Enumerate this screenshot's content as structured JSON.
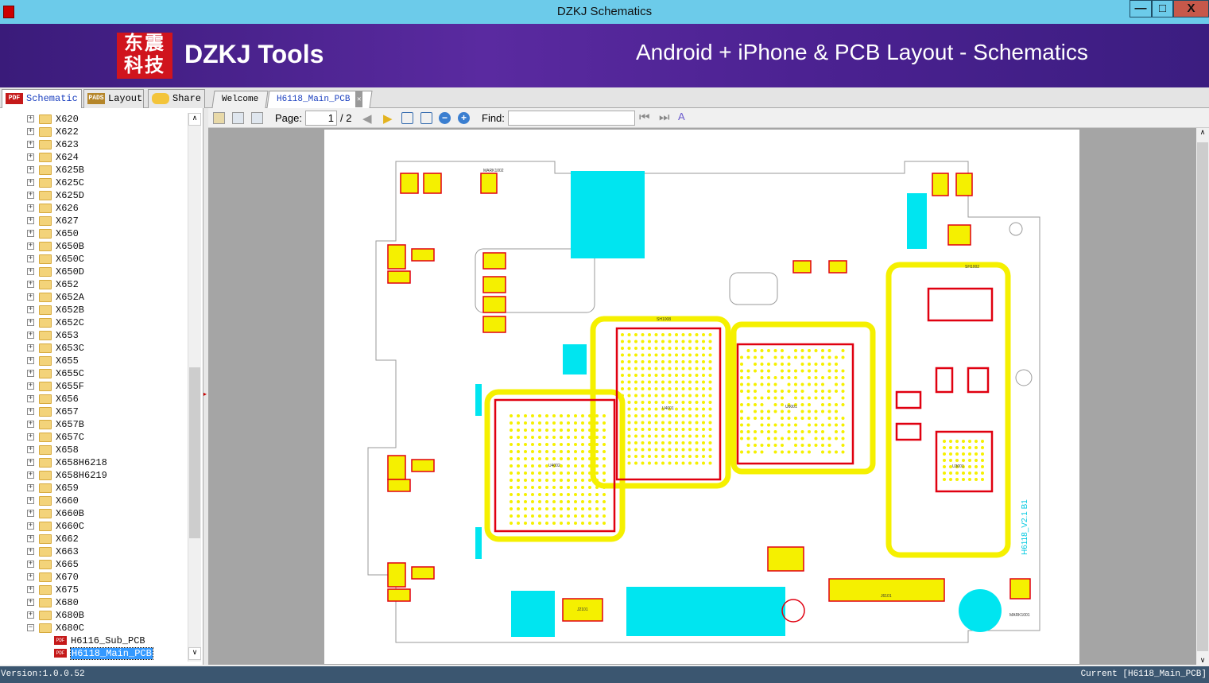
{
  "window": {
    "title": "DZKJ Schematics",
    "minimize": "—",
    "maximize": "□",
    "close": "X"
  },
  "banner": {
    "logo_text": "东震科技",
    "brand": "DZKJ Tools",
    "tagline": "Android + iPhone & PCB Layout - Schematics"
  },
  "left_tabs": [
    {
      "label": "Schematic",
      "icon": "pdf-icon",
      "badge": "PDF"
    },
    {
      "label": "Layout",
      "icon": "pads-icon",
      "badge": "PADS"
    },
    {
      "label": "Share",
      "icon": "cloud-share-icon"
    }
  ],
  "doc_tabs": [
    {
      "label": "Welcome"
    },
    {
      "label": "H6118_Main_PCB",
      "active": true
    }
  ],
  "toolbar": {
    "page_label": "Page:",
    "page_value": "1",
    "page_total": "/ 2",
    "find_label": "Find:",
    "find_value": ""
  },
  "tree": {
    "folders": [
      "X620",
      "X622",
      "X623",
      "X624",
      "X625B",
      "X625C",
      "X625D",
      "X626",
      "X627",
      "X650",
      "X650B",
      "X650C",
      "X650D",
      "X652",
      "X652A",
      "X652B",
      "X652C",
      "X653",
      "X653C",
      "X655",
      "X655C",
      "X655F",
      "X656",
      "X657",
      "X657B",
      "X657C",
      "X658",
      "X658H6218",
      "X658H6219",
      "X659",
      "X660",
      "X660B",
      "X660C",
      "X662",
      "X663",
      "X665",
      "X670",
      "X675",
      "X680",
      "X680B"
    ],
    "expanded": "X680C",
    "files": [
      "H6116_Sub_PCB",
      "H6118_Main_PCB"
    ],
    "selected": "H6118_Main_PCB"
  },
  "pcb": {
    "labels": {
      "u4001": "U4001",
      "u4002": "U4002",
      "u6001": "U6001",
      "u3001": "U3001",
      "j6101": "J6101",
      "j2101": "J2101",
      "version": "H6118_V2.1 B1",
      "mark1": "MARK1001",
      "mark2": "MARK1002",
      "sh1008": "SH1008",
      "sh1002": "SH1002"
    },
    "colors": {
      "pad": "#f5f000",
      "copper": "#00e5f0",
      "outline": "#e00010",
      "board": "#9a9a9a"
    }
  },
  "status": {
    "version": "Version:1.0.0.52",
    "current": "Current [H6118_Main_PCB]"
  }
}
